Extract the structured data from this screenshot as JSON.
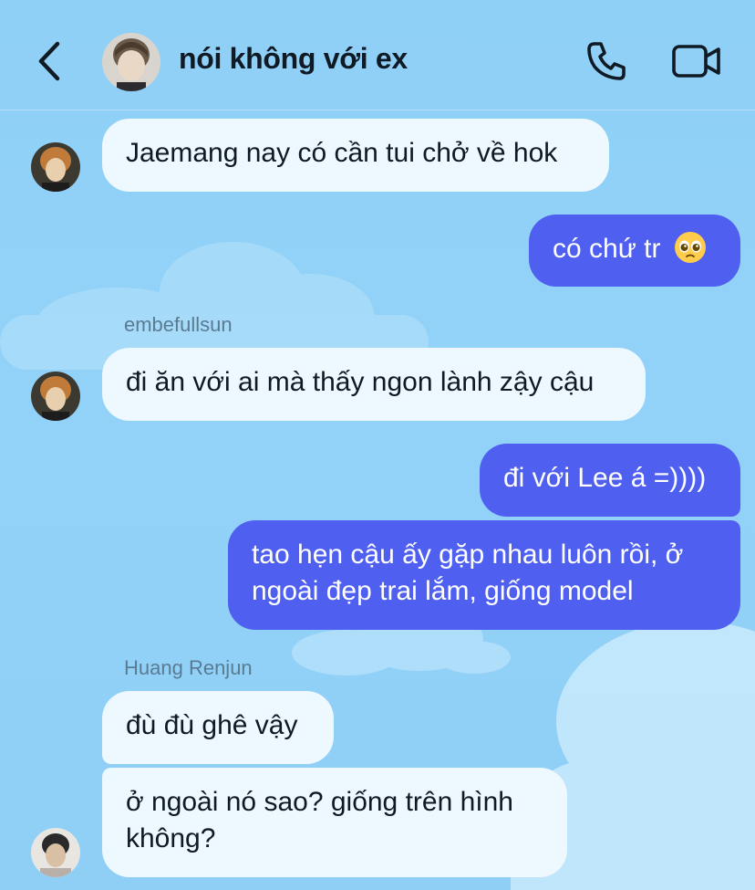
{
  "header": {
    "title": "nói không với ex",
    "back_icon": "chevron-left-icon",
    "call_icon": "phone-icon",
    "video_icon": "video-camera-icon"
  },
  "messages": [
    {
      "side": "incoming",
      "text": "Jaemang nay có cần tui chở về hok"
    },
    {
      "side": "outgoing",
      "text": "có chứ tr",
      "emoji": "pleading-face-emoji"
    },
    {
      "side": "incoming",
      "sender": "embefullsun",
      "text": "đi ăn với ai mà thấy ngon lành zậy cậu"
    },
    {
      "side": "outgoing",
      "text": "đi với Lee á =))))"
    },
    {
      "side": "outgoing",
      "lines": [
        "tao hẹn cậu ấy gặp nhau luôn rồi, ở",
        "ngoài đẹp trai lắm, giống model"
      ]
    },
    {
      "side": "incoming",
      "sender": "Huang Renjun",
      "text": "đù đù ghê vậy"
    },
    {
      "side": "incoming",
      "lines": [
        "ở ngoài nó sao? giống trên hình",
        "không?"
      ]
    }
  ],
  "colors": {
    "background": "#8fd0f7",
    "incoming_bubble": "#eef8ff",
    "outgoing_bubble": "#4f5ff0",
    "text_dark": "#0f1a24"
  }
}
